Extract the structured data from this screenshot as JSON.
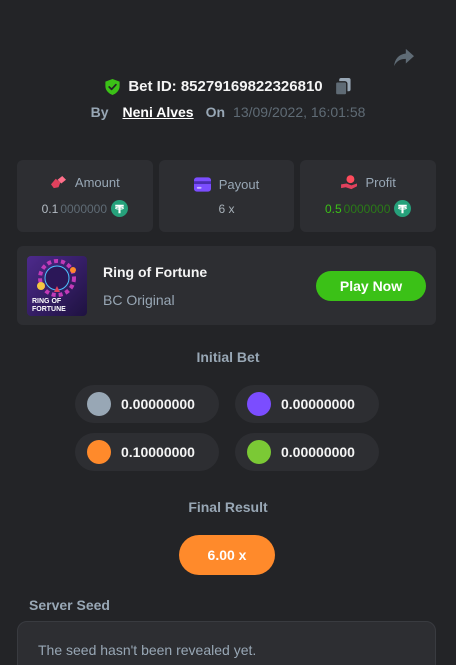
{
  "bet": {
    "id_label": "Bet ID: 85279169822326810",
    "by_label": "By",
    "user": "Neni Alves",
    "on_label": "On",
    "datetime": "13/09/2022, 16:01:58"
  },
  "stats": {
    "amount": {
      "label": "Amount",
      "value_main": "0.1",
      "value_rest": "0000000",
      "icon": "usdt-icon"
    },
    "payout": {
      "label": "Payout",
      "value": "6 x"
    },
    "profit": {
      "label": "Profit",
      "value_main": "0.5",
      "value_rest": "0000000",
      "icon": "usdt-icon"
    }
  },
  "game": {
    "name": "Ring of Fortune",
    "subtitle": "BC Original",
    "play_label": "Play Now",
    "thumb_text_line1": "RING OF",
    "thumb_text_line2": "FORTUNE"
  },
  "initial_bet": {
    "title": "Initial Bet",
    "chips": [
      {
        "color": "grey",
        "hex": "#98a7b5",
        "value": "0.00000000"
      },
      {
        "color": "purple",
        "hex": "#7b4dff",
        "value": "0.00000000"
      },
      {
        "color": "orange",
        "hex": "#ff8a2b",
        "value": "0.10000000"
      },
      {
        "color": "green",
        "hex": "#7bc935",
        "value": "0.00000000"
      }
    ]
  },
  "final_result": {
    "title": "Final Result",
    "value": "6.00 x"
  },
  "server_seed": {
    "label": "Server Seed",
    "text": "The seed hasn't been revealed yet."
  },
  "colors": {
    "background": "#232427",
    "card": "#2d2e32",
    "accent_green": "#3bc117",
    "accent_orange": "#ff8a2b",
    "muted_text": "#98a7b5"
  }
}
